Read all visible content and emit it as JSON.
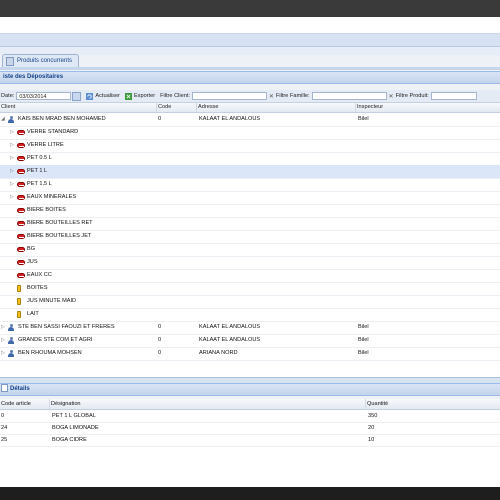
{
  "tab": {
    "label": "Produits concurrents"
  },
  "panel": {
    "title": "iste des Dépositaires"
  },
  "toolbar": {
    "date_label": "Date:",
    "date_value": "03/03/2014",
    "actualiser": "Actualiser",
    "exporter": "Exporter",
    "filtre_client": "Filtre Client:",
    "filtre_famille": "Filtre Famille:",
    "filtre_produit": "Filtre Produit:"
  },
  "grid": {
    "headers": [
      "Client",
      "Code",
      "Adresse",
      "Inspecteur"
    ],
    "rows": [
      {
        "level": 0,
        "icon": "person",
        "expanded": true,
        "client": "KAIS BEN MRAD BEN MOHAMED",
        "code": "0",
        "adresse": "KALAAT EL ANDALOUS",
        "inspecteur": "Bilel"
      },
      {
        "level": 1,
        "icon": "red",
        "arrow": true,
        "client": "VERRE STANDARD"
      },
      {
        "level": 1,
        "icon": "red",
        "arrow": true,
        "client": "VERRE LITRE"
      },
      {
        "level": 1,
        "icon": "red",
        "arrow": true,
        "client": "PET 0.5 L"
      },
      {
        "level": 1,
        "icon": "red",
        "arrow": true,
        "client": "PET 1 L",
        "selected": true
      },
      {
        "level": 1,
        "icon": "red",
        "arrow": true,
        "client": "PET 1,5 L"
      },
      {
        "level": 1,
        "icon": "red",
        "arrow": true,
        "client": "EAUX MINERALES"
      },
      {
        "level": 1,
        "icon": "red",
        "client": "BIERE BOITES"
      },
      {
        "level": 1,
        "icon": "red",
        "client": "BIERE BOUTEILLES RET"
      },
      {
        "level": 1,
        "icon": "red",
        "client": "BIERE BOUTEILLES JET"
      },
      {
        "level": 1,
        "icon": "red",
        "client": "BG"
      },
      {
        "level": 1,
        "icon": "red",
        "client": "JUS"
      },
      {
        "level": 1,
        "icon": "red",
        "client": "EAUX CC"
      },
      {
        "level": 1,
        "icon": "yellow",
        "client": "BOITES"
      },
      {
        "level": 1,
        "icon": "yellow",
        "client": "JUS MINUTE MAID"
      },
      {
        "level": 1,
        "icon": "yellow",
        "client": "LAIT"
      },
      {
        "level": 0,
        "icon": "person",
        "arrow": true,
        "client": "STE BEN SASSI FAOUZI ET FRERES",
        "code": "0",
        "adresse": "KALAAT EL ANDALOUS",
        "inspecteur": "Bilel"
      },
      {
        "level": 0,
        "icon": "person",
        "arrow": true,
        "client": "GRANDE STE COM ET AGRI",
        "code": "0",
        "adresse": "KALAAT EL ANDALOUS",
        "inspecteur": "Bilel"
      },
      {
        "level": 0,
        "icon": "person",
        "arrow": true,
        "client": "BEN RHOUMA MOHSEN",
        "code": "0",
        "adresse": "ARIANA NORD",
        "inspecteur": "Bilel"
      }
    ]
  },
  "details": {
    "title": "Détails",
    "headers": [
      "Code article",
      "Désignation",
      "Quantité"
    ],
    "rows": [
      {
        "code": "0",
        "designation": "PET 1 L GLOBAL",
        "quantite": "350"
      },
      {
        "code": "24",
        "designation": "BOGA LIMONADE",
        "quantite": "20"
      },
      {
        "code": "25",
        "designation": "BOGA CIDRE",
        "quantite": "10"
      }
    ]
  }
}
